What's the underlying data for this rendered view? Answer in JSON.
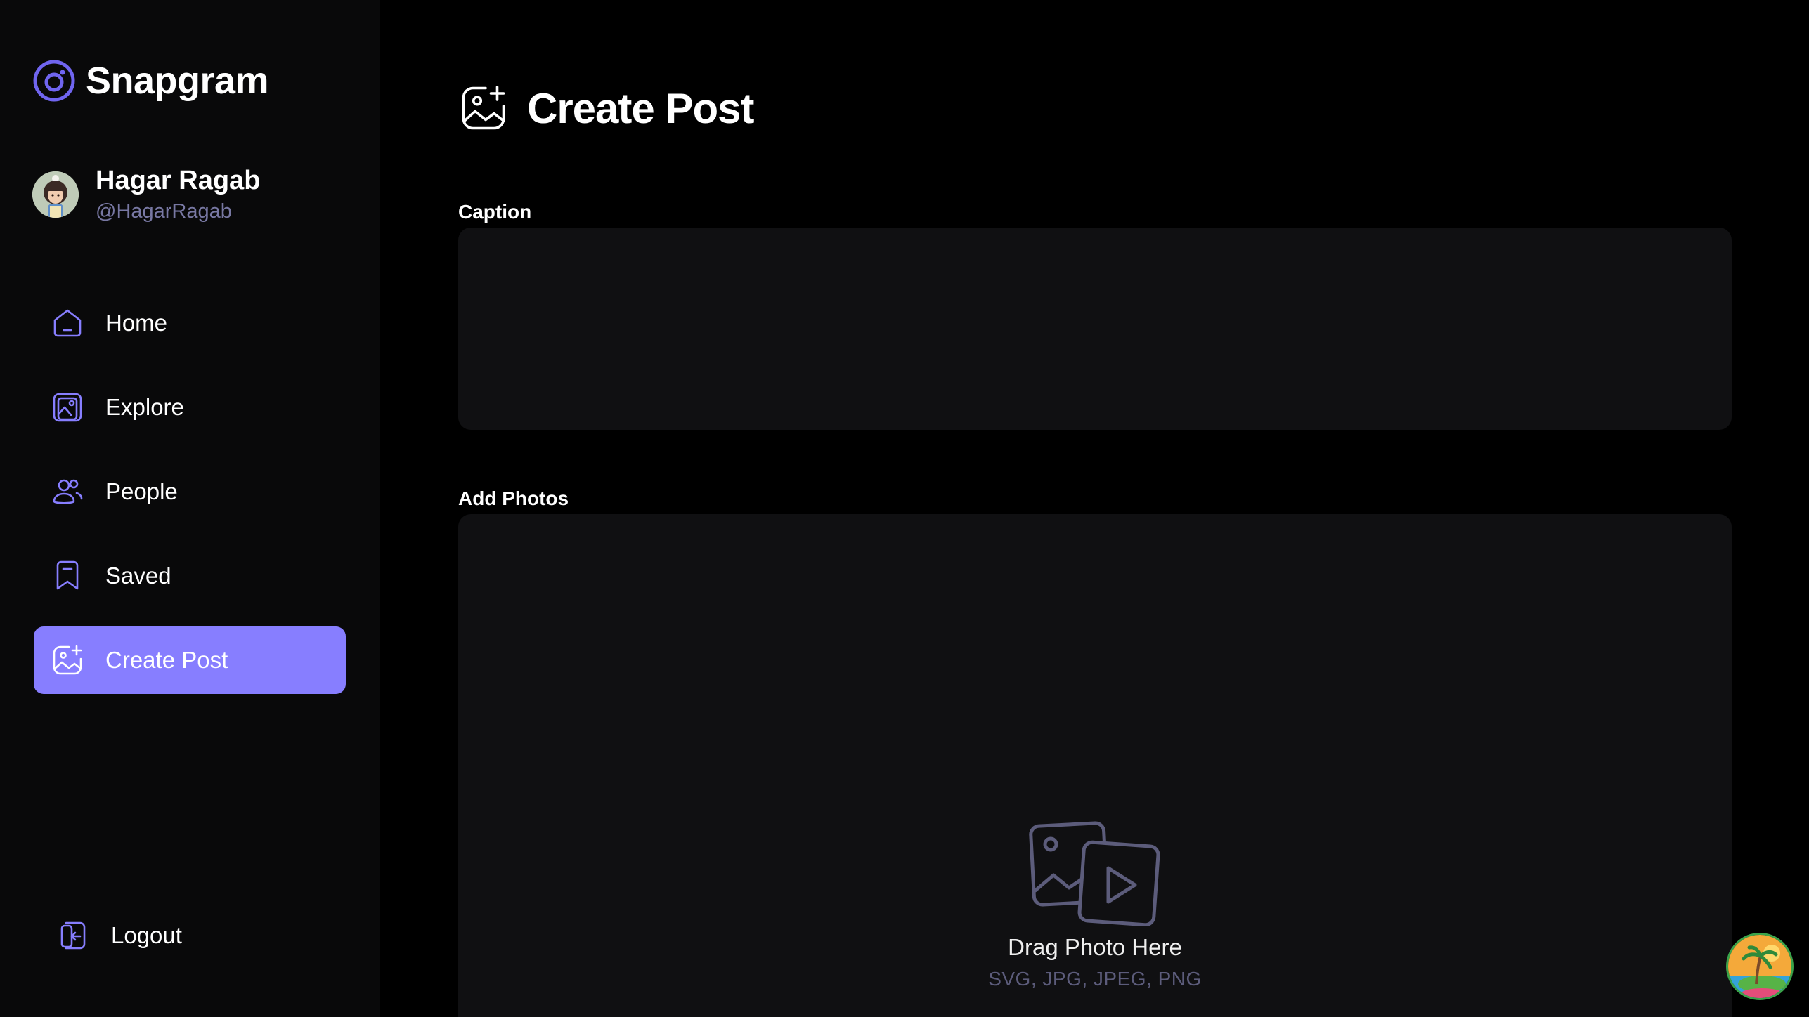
{
  "app": {
    "name": "Snapgram",
    "accent": "#877eff"
  },
  "user": {
    "name": "Hagar Ragab",
    "handle": "@HagarRagab"
  },
  "sidebar": {
    "items": [
      {
        "label": "Home",
        "icon": "home-icon",
        "active": false
      },
      {
        "label": "Explore",
        "icon": "gallery-icon",
        "active": false
      },
      {
        "label": "People",
        "icon": "people-icon",
        "active": false
      },
      {
        "label": "Saved",
        "icon": "bookmark-icon",
        "active": false
      },
      {
        "label": "Create Post",
        "icon": "gallery-add-icon",
        "active": true
      }
    ],
    "logout_label": "Logout"
  },
  "page": {
    "title": "Create Post",
    "caption_label": "Caption",
    "caption_value": "",
    "photos_label": "Add Photos",
    "drop_title": "Drag Photo Here",
    "drop_formats": "SVG, JPG, JPEG, PNG"
  }
}
